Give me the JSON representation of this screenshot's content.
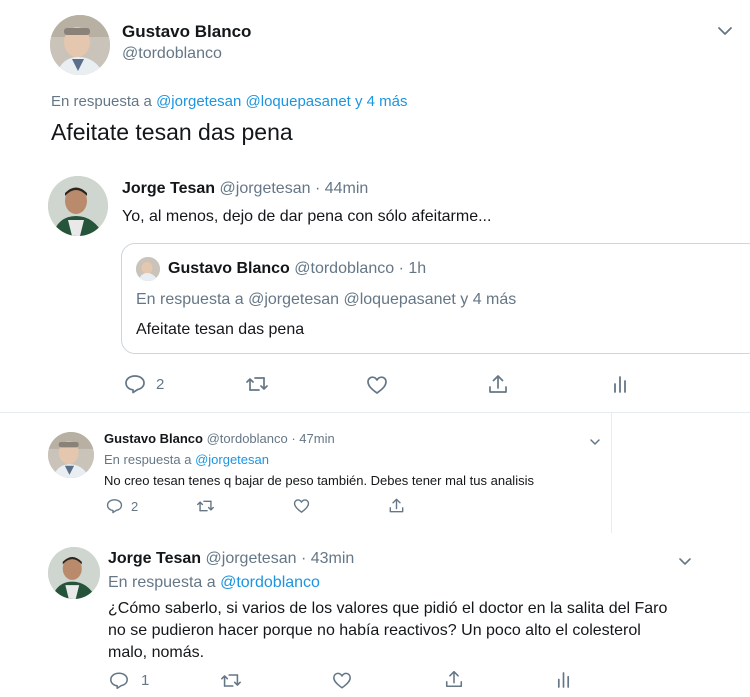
{
  "tweet_main": {
    "author_name": "Gustavo Blanco",
    "author_handle": "@tordoblanco",
    "reply_prefix": "En respuesta a",
    "reply_mentions": "@jorgetesan @loquepasanet y 4 más",
    "text": "Afeitate tesan das pena"
  },
  "reply_1": {
    "author_name": "Jorge Tesan",
    "author_handle": "@jorgetesan",
    "time": "· 44min",
    "text": "Yo, al menos, dejo de dar pena con sólo afeitarme...",
    "quote": {
      "author_name": "Gustavo Blanco",
      "author_handle": "@tordoblanco",
      "time": "· 1h",
      "reply_prefix": "En respuesta a",
      "reply_mentions": "@jorgetesan @loquepasanet y 4 más",
      "text": "Afeitate tesan das pena"
    },
    "actions": {
      "reply_count": "2",
      "retweet_count": "",
      "like_count": ""
    }
  },
  "reply_2": {
    "author_name": "Gustavo Blanco",
    "author_handle": "@tordoblanco",
    "time": "· 47min",
    "reply_prefix": "En respuesta a",
    "reply_mentions": "@jorgetesan",
    "text": "No creo tesan tenes q bajar de peso también. Debes tener mal tus analisis",
    "actions": {
      "reply_count": "2"
    }
  },
  "reply_3": {
    "author_name": "Jorge Tesan",
    "author_handle": "@jorgetesan",
    "time": "· 43min",
    "reply_prefix": "En respuesta a",
    "reply_mentions": "@tordoblanco",
    "text_lines": [
      "¿Cómo saberlo, si varios de los valores que pidió el doctor en la salita del Faro",
      "no se pudieron hacer porque no había reactivos? Un poco alto el colesterol",
      "malo, nomás."
    ],
    "actions": {
      "reply_count": "1"
    }
  },
  "icons": {
    "reply": "reply-icon",
    "retweet": "retweet-icon",
    "like": "heart-icon",
    "share": "share-icon",
    "analytics": "analytics-icon",
    "menu": "chevron-down-icon"
  },
  "colors": {
    "link": "#1b95e0",
    "muted": "#657786",
    "text": "#14171a",
    "border": "#ccd6dd"
  }
}
